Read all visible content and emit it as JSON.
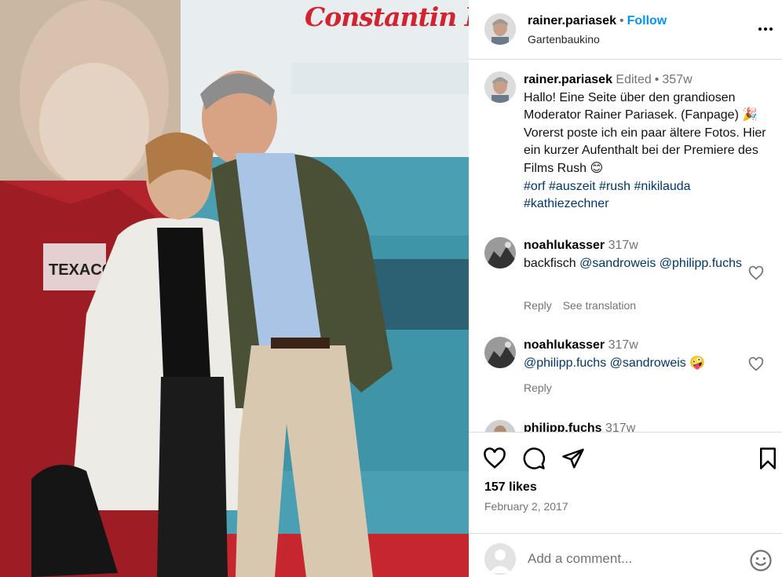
{
  "photo": {
    "brand_text": "Constantin Film",
    "poster_text": "TEXACO"
  },
  "post": {
    "author": {
      "username": "rainer.pariasek",
      "follow_label": "Follow",
      "location": "Gartenbaukino"
    },
    "caption": {
      "username": "rainer.pariasek",
      "edited_label": "Edited",
      "age": "357w",
      "text": "Hallo! Eine Seite über den grandiosen Moderator Rainer Pariasek. (Fanpage) 🎉 Vorerst poste ich ein paar ältere Fotos. Hier ein kurzer Aufenthalt bei der Premiere des Films Rush 😊",
      "hashtags": "#orf #auszeit #rush #nikilauda #kathiezechner"
    },
    "comments": [
      {
        "username": "noahlukasser",
        "age": "317w",
        "text": "backfisch",
        "mentions": "@sandroweis @philipp.fuchs",
        "reply_label": "Reply",
        "translate_label": "See translation"
      },
      {
        "username": "noahlukasser",
        "age": "317w",
        "text": "@philipp.fuchs @sandroweis 🤪",
        "reply_label": "Reply"
      },
      {
        "username": "philipp.fuchs",
        "age": "317w"
      }
    ],
    "likes": "157 likes",
    "date": "February 2, 2017",
    "add_comment_placeholder": "Add a comment...",
    "icons": [
      "heart-icon",
      "comment-icon",
      "share-icon",
      "bookmark-icon",
      "emoji-icon",
      "more-options-icon"
    ]
  }
}
